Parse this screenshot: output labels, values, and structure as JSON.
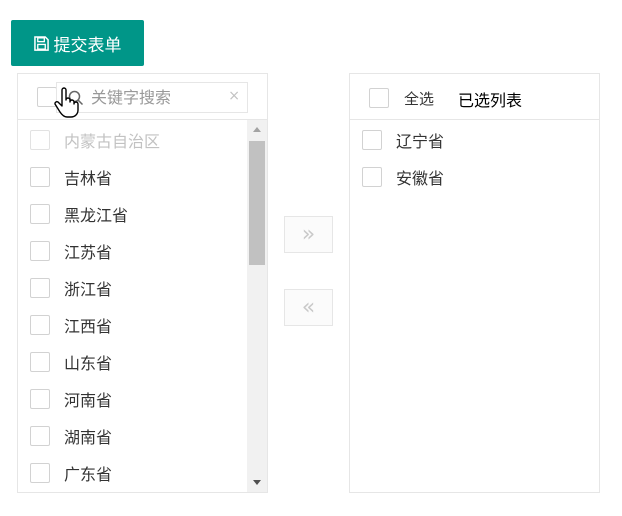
{
  "toolbar": {
    "submit_label": "提交表单",
    "submit_icon": "save-icon"
  },
  "left_panel": {
    "search": {
      "placeholder": "关键字搜索",
      "value": "",
      "clear_symbol": "×"
    },
    "items": [
      {
        "label": "内蒙古自治区",
        "disabled": true
      },
      {
        "label": "吉林省",
        "disabled": false
      },
      {
        "label": "黑龙江省",
        "disabled": false
      },
      {
        "label": "江苏省",
        "disabled": false
      },
      {
        "label": "浙江省",
        "disabled": false
      },
      {
        "label": "江西省",
        "disabled": false
      },
      {
        "label": "山东省",
        "disabled": false
      },
      {
        "label": "河南省",
        "disabled": false
      },
      {
        "label": "湖南省",
        "disabled": false
      },
      {
        "label": "广东省",
        "disabled": false
      }
    ]
  },
  "transfer": {
    "to_right_symbol": "»",
    "to_left_symbol": "«"
  },
  "right_panel": {
    "select_all_label": "全选",
    "title": "已选列表",
    "items": [
      {
        "label": "辽宁省"
      },
      {
        "label": "安徽省"
      }
    ]
  },
  "colors": {
    "primary": "#009688",
    "border": "#e6e6e6",
    "disabled_text": "#c2c2c2"
  }
}
